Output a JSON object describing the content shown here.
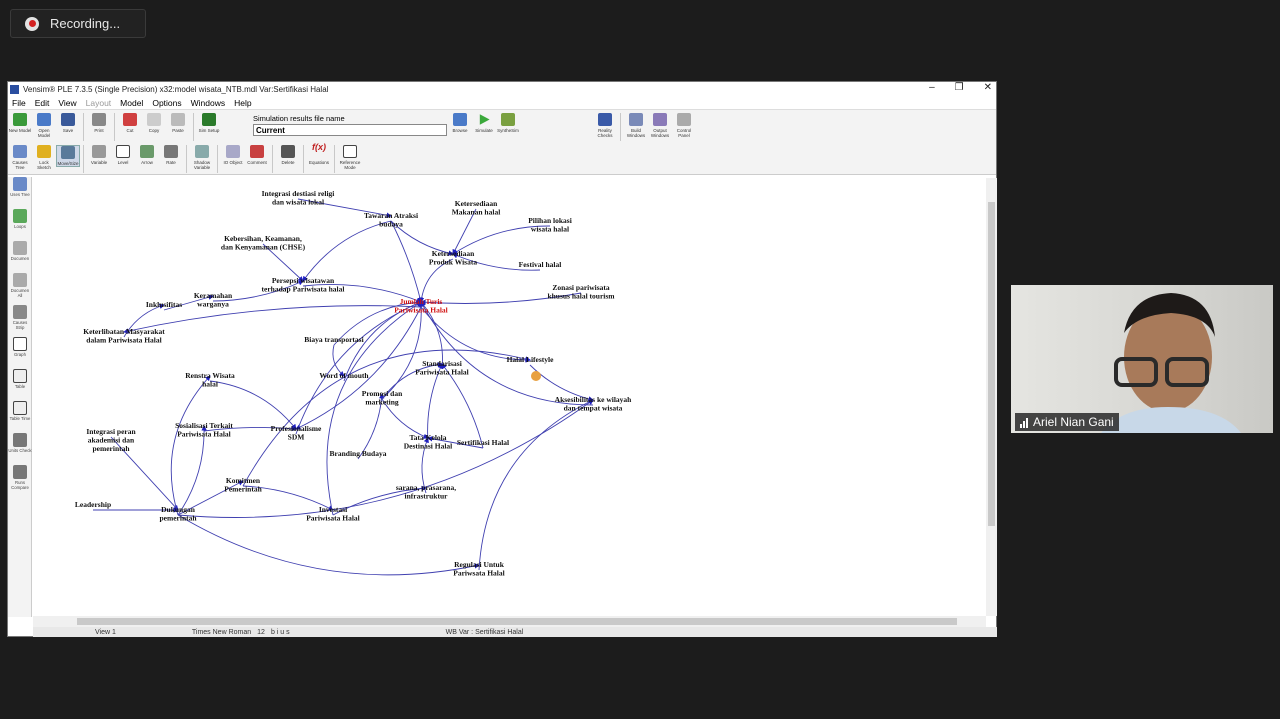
{
  "recording": {
    "label": "Recording..."
  },
  "window": {
    "title": "Vensim® PLE 7.3.5 (Single Precision) x32:model wisata_NTB.mdl Var:Sertifikasi Halal",
    "controls": [
      "–",
      "❐",
      "✕"
    ]
  },
  "menu": [
    "File",
    "Edit",
    "View",
    "Layout",
    "Model",
    "Options",
    "Windows",
    "Help"
  ],
  "toolbar1": {
    "buttons": [
      "New Model",
      "Open Model",
      "Save",
      "Print",
      "Cut",
      "Copy",
      "Paste",
      "Sim Setup"
    ],
    "sim_label": "Simulation results file name",
    "sim_value": "Current",
    "right_buttons": [
      "Browse",
      "Simulate",
      "SyntheSim",
      "Reality Checks",
      "Build Windows",
      "Output Windows",
      "Control Panel"
    ]
  },
  "toolbar2": {
    "buttons": [
      "Causes Tree",
      "Lock Sketch",
      "Move/Size",
      "Variable",
      "Level",
      "Arrow",
      "Rate",
      "Shadow Variable",
      "IO Object",
      "Comment",
      "Delete",
      "Equations",
      "Reference Mode"
    ]
  },
  "sidebar": [
    "Uses Tree",
    "Loops",
    "Documen",
    "Documen All",
    "Causes Strip",
    "Graph",
    "Table",
    "Table Time",
    "Units Check",
    "Runs Compare"
  ],
  "diagram": {
    "variables": [
      {
        "id": "integrasi",
        "lines": [
          "Integrasi destiasi religi",
          "dan wisata lokal"
        ]
      },
      {
        "id": "tawaran",
        "lines": [
          "Tawaran Atraksi",
          "budaya"
        ]
      },
      {
        "id": "ketersediaan_makanan",
        "lines": [
          "Ketersediaan",
          "Makanan halal"
        ]
      },
      {
        "id": "pilihan_lokasi",
        "lines": [
          "Pilihan lokasi",
          "wisata halal"
        ]
      },
      {
        "id": "kebersihan",
        "lines": [
          "Kebersihan, Keamanan,",
          "dan Kenyamanan (CHSE)"
        ]
      },
      {
        "id": "ketersediaan_produk",
        "lines": [
          "Ketersediaan",
          "Produk Wisata"
        ]
      },
      {
        "id": "festival",
        "lines": [
          "Festival halal"
        ]
      },
      {
        "id": "persepsi",
        "lines": [
          "Persepsi wisatawan",
          "terhadap Pariwisata halal"
        ]
      },
      {
        "id": "zonasi",
        "lines": [
          "Zonasi pariwisata",
          "khusus halal tourism"
        ]
      },
      {
        "id": "keramahan",
        "lines": [
          "Keramahan",
          "warganya"
        ]
      },
      {
        "id": "inklusifitas",
        "lines": [
          "Inklusifitas"
        ]
      },
      {
        "id": "jumlah",
        "lines": [
          "Jumlah Turis",
          "Pariwisata Halal"
        ]
      },
      {
        "id": "keterlibatan",
        "lines": [
          "Keterlibatan Masyarakat",
          "dalam Pariwisata Halal"
        ]
      },
      {
        "id": "biaya",
        "lines": [
          "Biaya transportasi"
        ]
      },
      {
        "id": "halal_lifestyle",
        "lines": [
          "Halal Lifestyle"
        ]
      },
      {
        "id": "standarisasi",
        "lines": [
          "Standarisasi",
          "Pariwisata Halal"
        ]
      },
      {
        "id": "word",
        "lines": [
          "Word of mouth"
        ]
      },
      {
        "id": "renstra",
        "lines": [
          "Renstra Wisata",
          "halal"
        ]
      },
      {
        "id": "promosi",
        "lines": [
          "Promosi dan",
          "marketing"
        ]
      },
      {
        "id": "aksesibilitas",
        "lines": [
          "Aksesibilitas ke wilayah",
          "dan tempat wisata"
        ]
      },
      {
        "id": "integrasi_peran",
        "lines": [
          "Integrasi peran",
          "akademisi dan",
          "pemerintah"
        ]
      },
      {
        "id": "sosialisasi",
        "lines": [
          "Sosialisasi Terkait",
          "Pariwisata Halal"
        ]
      },
      {
        "id": "profesionalisme",
        "lines": [
          "Profesionalisme",
          "SDM"
        ]
      },
      {
        "id": "tata_kelola",
        "lines": [
          "Tata Kelola",
          "Destinasi Halal"
        ]
      },
      {
        "id": "sertifikasi",
        "lines": [
          "Sertifikasi Halal"
        ]
      },
      {
        "id": "branding",
        "lines": [
          "Branding Budaya"
        ]
      },
      {
        "id": "komitmen",
        "lines": [
          "Komitmen",
          "Pemerintah"
        ]
      },
      {
        "id": "sarana",
        "lines": [
          "sarana, prasarana,",
          "infrastruktur"
        ]
      },
      {
        "id": "leadership",
        "lines": [
          "Leadership"
        ]
      },
      {
        "id": "dukungan",
        "lines": [
          "Dukungan",
          "pemerintah"
        ]
      },
      {
        "id": "investasi",
        "lines": [
          "Investasi",
          "Pariwisata Halal"
        ]
      },
      {
        "id": "regulasi",
        "lines": [
          "Regulasi Untuk",
          "Pariwsata Halal"
        ]
      }
    ]
  },
  "statusbar": {
    "view": "View 1",
    "font": "Times New Roman",
    "size": "12",
    "styles": "b i u s",
    "var": "WB Var : Sertifikasi Halal"
  },
  "video": {
    "name": "Ariel Nian Gani"
  }
}
